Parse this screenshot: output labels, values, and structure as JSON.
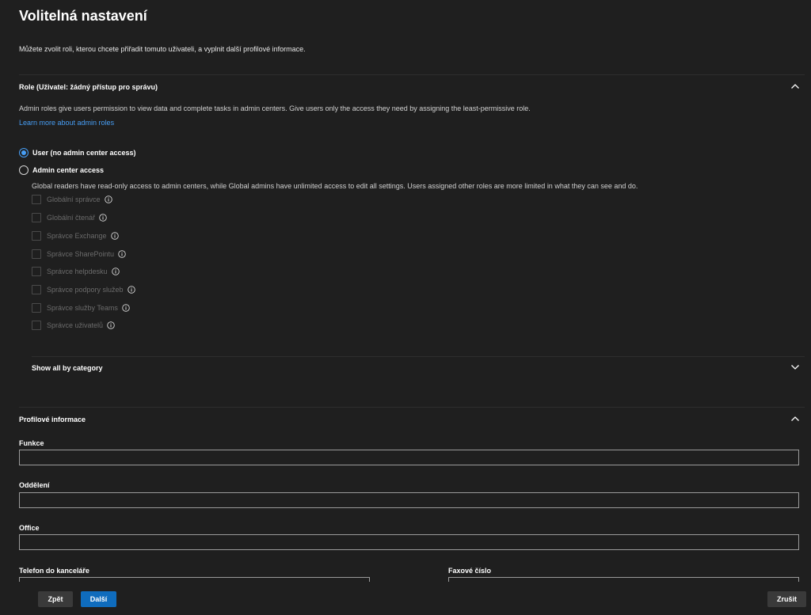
{
  "page": {
    "title": "Volitelná nastavení",
    "intro": "Můžete zvolit roli, kterou chcete přiřadit tomuto uživateli, a vyplnit další profilové informace."
  },
  "roles": {
    "title": "Role (Uživatel: žádný přístup pro správu)",
    "description": "Admin roles give users permission to view data and complete tasks in admin centers. Give users only the access they need by assigning the least-permissive role.",
    "learn_more": "Learn more about admin roles",
    "options": [
      {
        "label": "User (no admin center access)",
        "selected": true
      },
      {
        "label": "Admin center access",
        "selected": false
      }
    ],
    "admin_description": "Global readers have read-only access to admin centers, while Global admins have unlimited access to edit all settings. Users assigned other roles are more limited in what they can see and do.",
    "checkboxes": [
      {
        "label": "Globální správce",
        "icon": "info-icon"
      },
      {
        "label": "Globální čtenář",
        "icon": "info-icon"
      },
      {
        "label": "Správce Exchange",
        "icon": "info-icon"
      },
      {
        "label": "Správce SharePointu",
        "icon": "info-icon"
      },
      {
        "label": "Správce helpdesku",
        "icon": "info-icon"
      },
      {
        "label": "Správce podpory služeb",
        "icon": "info-icon"
      },
      {
        "label": "Správce služby Teams",
        "icon": "info-icon"
      },
      {
        "label": "Správce uživatelů",
        "icon": "info-icon"
      }
    ],
    "show_all": "Show all by category"
  },
  "profile": {
    "title": "Profilové informace",
    "fields": {
      "job_title": {
        "label": "Funkce",
        "value": ""
      },
      "department": {
        "label": "Oddělení",
        "value": ""
      },
      "office": {
        "label": "Office",
        "value": ""
      },
      "office_phone": {
        "label": "Telefon do kanceláře",
        "value": ""
      },
      "fax": {
        "label": "Faxové číslo",
        "value": ""
      }
    }
  },
  "footer": {
    "back": "Zpět",
    "next": "Další",
    "cancel": "Zrušit"
  },
  "colors": {
    "background": "#1f1f1f",
    "accent": "#0f6cbd",
    "link": "#479ef5"
  }
}
